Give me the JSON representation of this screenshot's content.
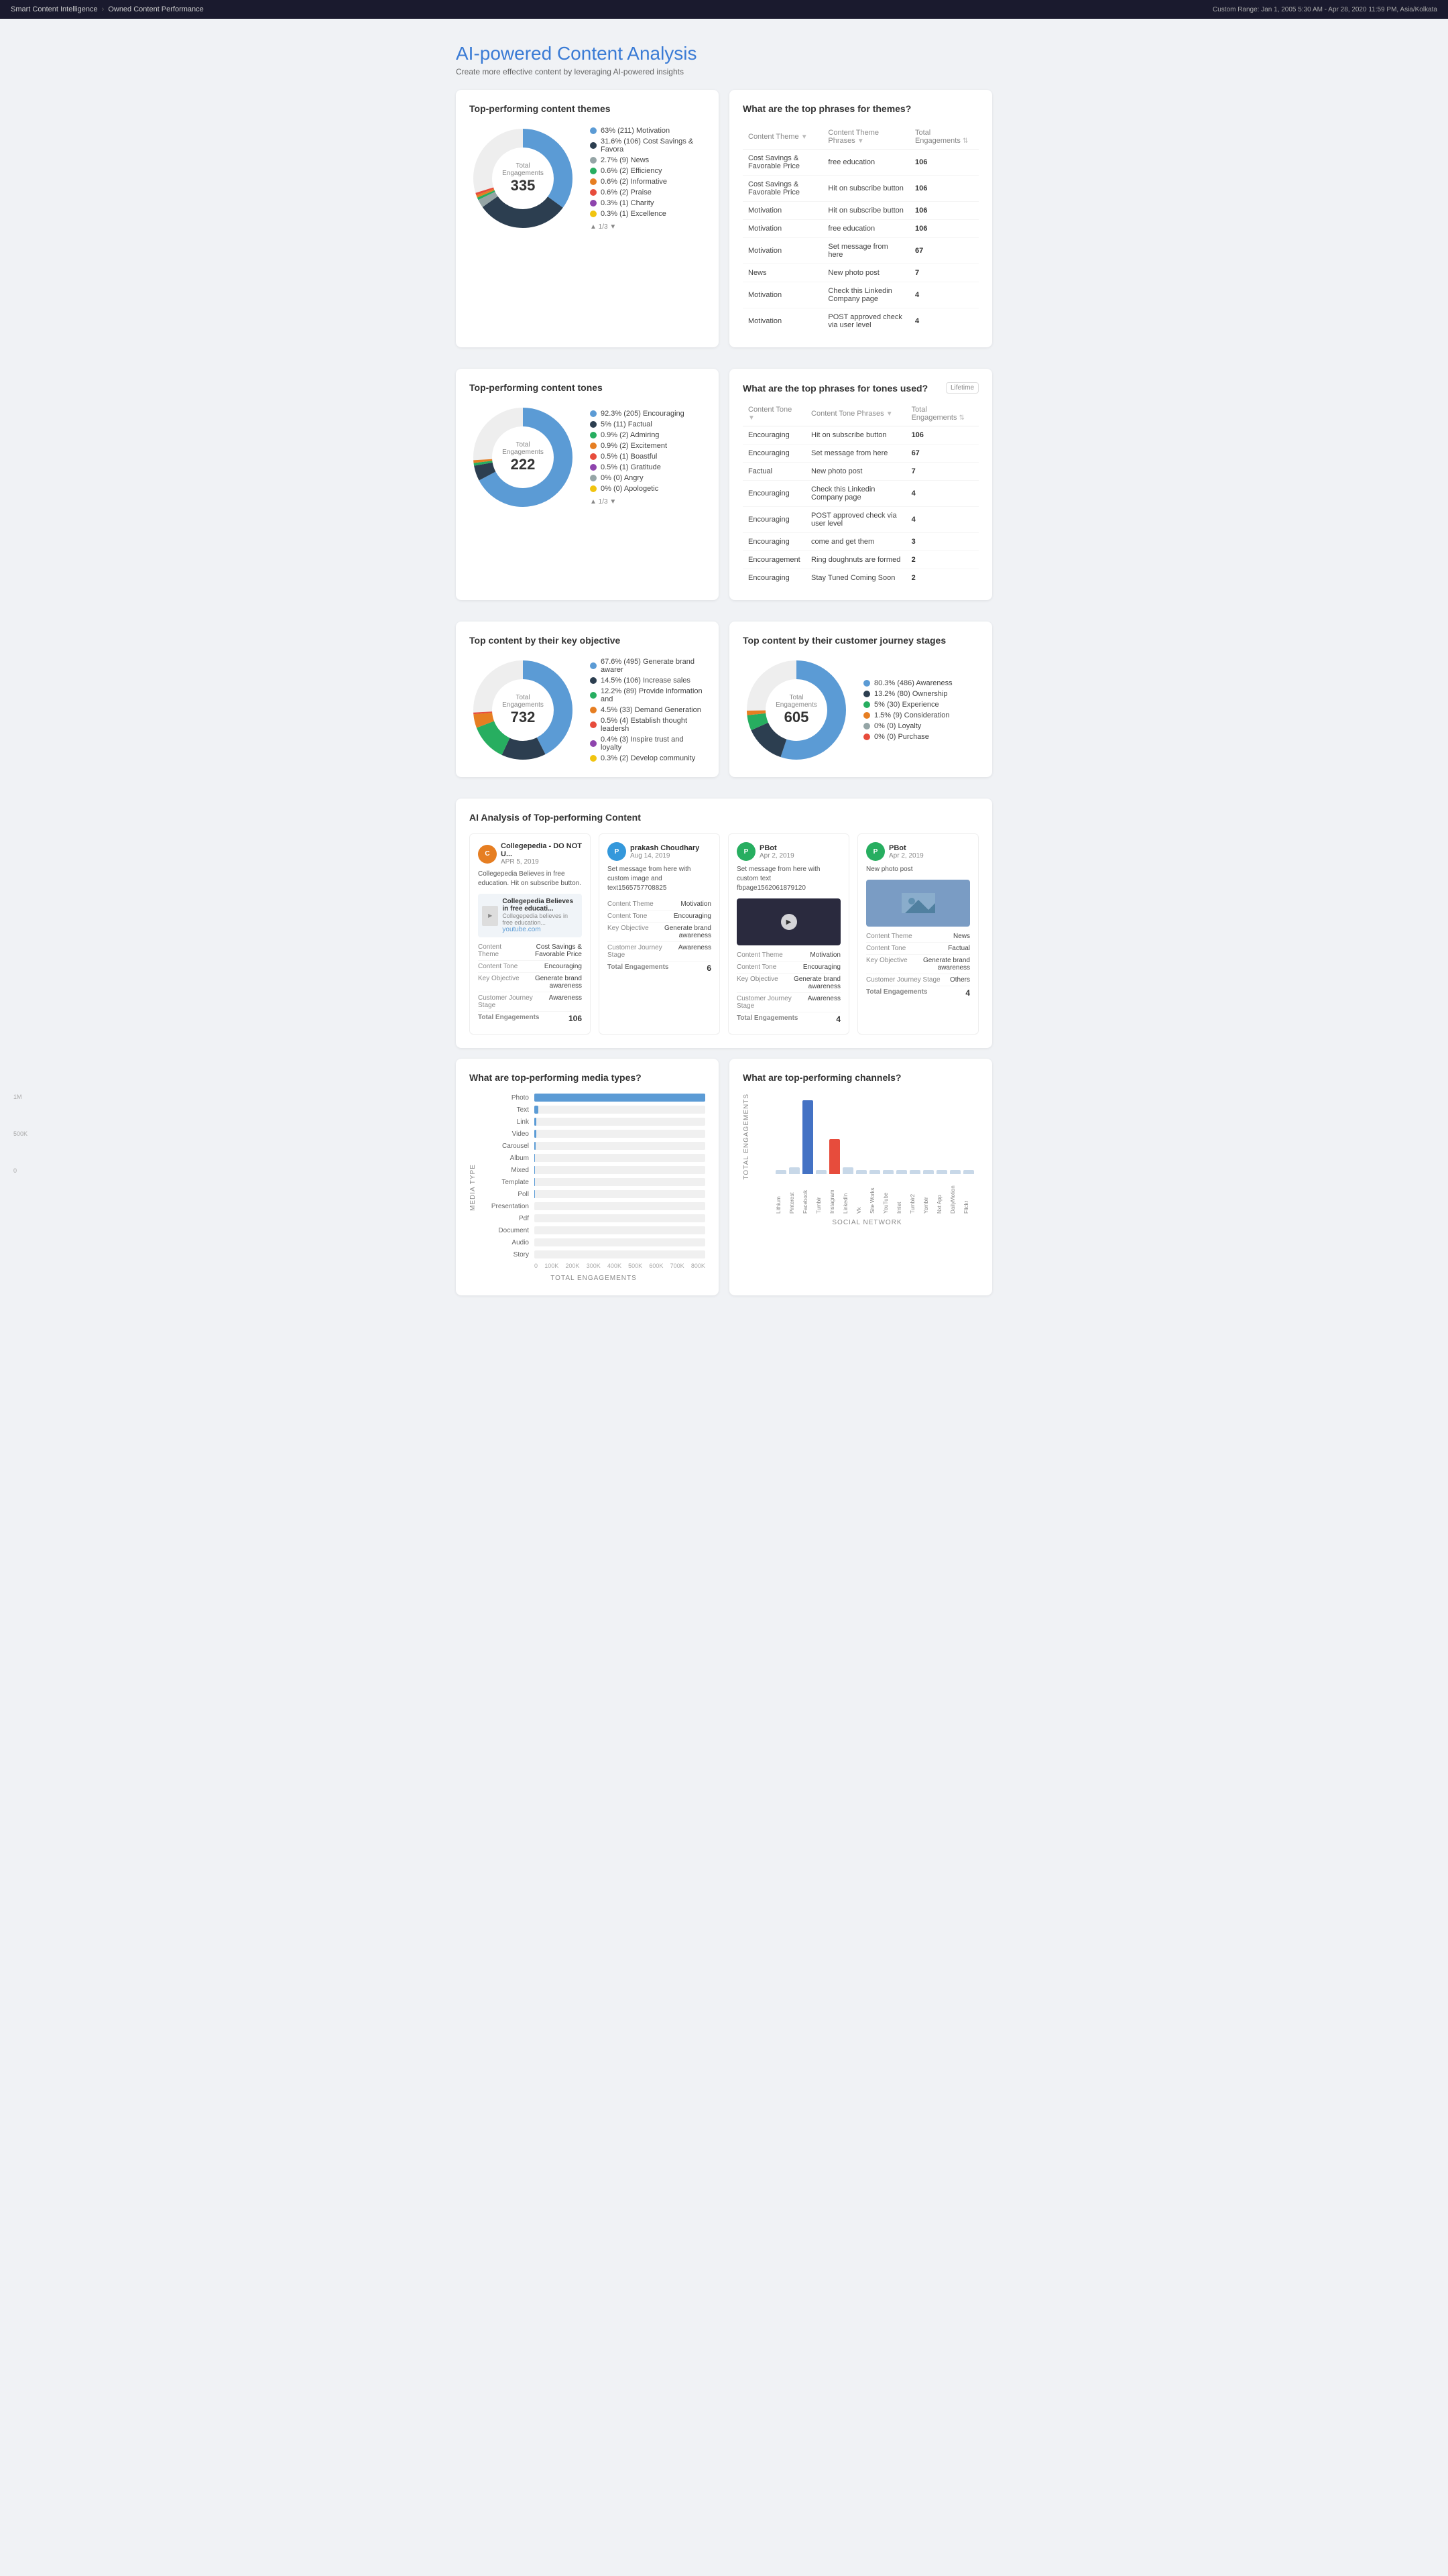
{
  "nav": {
    "brand": "Smart Content Intelligence",
    "breadcrumb": "Owned Content Performance",
    "dateRange": "Custom Range: Jan 1, 2005 5:30 AM - Apr 28, 2020 11:59 PM, Asia/Kolkata"
  },
  "pageHeader": {
    "title": "AI-powered Content Analysis",
    "subtitle": "Create more effective content by leveraging AI-powered insights"
  },
  "topThemes": {
    "sectionTitle": "Top-performing content themes",
    "totalEngagementsLabel": "Total Engagements",
    "totalEngagements": "335",
    "legend": [
      {
        "color": "#5b9bd5",
        "text": "63% (211) Motivation"
      },
      {
        "color": "#2c3e50",
        "text": "31.6% (106) Cost Savings & Favora"
      },
      {
        "color": "#95a5a6",
        "text": "2.7% (9) News"
      },
      {
        "color": "#27ae60",
        "text": "0.6% (2) Efficiency"
      },
      {
        "color": "#e67e22",
        "text": "0.6% (2) Informative"
      },
      {
        "color": "#e74c3c",
        "text": "0.6% (2) Praise"
      },
      {
        "color": "#8e44ad",
        "text": "0.3% (1) Charity"
      },
      {
        "color": "#f1c40f",
        "text": "0.3% (1) Excellence"
      }
    ],
    "moreLabel": "▲ 1/3 ▼"
  },
  "topThemePhrases": {
    "sectionTitle": "What are the top phrases for themes?",
    "columns": [
      "Content Theme",
      "Content Theme Phrases",
      "Total Engagements"
    ],
    "rows": [
      {
        "theme": "Cost Savings & Favorable Price",
        "phrase": "free education",
        "engagements": "106"
      },
      {
        "theme": "Cost Savings & Favorable Price",
        "phrase": "Hit on subscribe button",
        "engagements": "106"
      },
      {
        "theme": "Motivation",
        "phrase": "Hit on subscribe button",
        "engagements": "106"
      },
      {
        "theme": "Motivation",
        "phrase": "free education",
        "engagements": "106"
      },
      {
        "theme": "Motivation",
        "phrase": "Set message from here",
        "engagements": "67"
      },
      {
        "theme": "News",
        "phrase": "New photo post",
        "engagements": "7"
      },
      {
        "theme": "Motivation",
        "phrase": "Check this Linkedin Company page",
        "engagements": "4"
      },
      {
        "theme": "Motivation",
        "phrase": "POST approved check via user level",
        "engagements": "4"
      }
    ]
  },
  "topTones": {
    "sectionTitle": "Top-performing content tones",
    "totalEngagementsLabel": "Total Engagements",
    "totalEngagements": "222",
    "legend": [
      {
        "color": "#5b9bd5",
        "text": "92.3% (205) Encouraging"
      },
      {
        "color": "#2c3e50",
        "text": "5% (11) Factual"
      },
      {
        "color": "#27ae60",
        "text": "0.9% (2) Admiring"
      },
      {
        "color": "#e67e22",
        "text": "0.9% (2) Excitement"
      },
      {
        "color": "#e74c3c",
        "text": "0.5% (1) Boastful"
      },
      {
        "color": "#8e44ad",
        "text": "0.5% (1) Gratitude"
      },
      {
        "color": "#95a5a6",
        "text": "0% (0) Angry"
      },
      {
        "color": "#f1c40f",
        "text": "0% (0) Apologetic"
      }
    ],
    "moreLabel": "▲ 1/3 ▼"
  },
  "topTonePhrases": {
    "sectionTitle": "What are the top phrases for tones used?",
    "lifetimeLabel": "Lifetime",
    "columns": [
      "Content Tone",
      "Content Tone Phrases",
      "Total Engagements"
    ],
    "rows": [
      {
        "tone": "Encouraging",
        "phrase": "Hit on subscribe button",
        "engagements": "106"
      },
      {
        "tone": "Encouraging",
        "phrase": "Set message from here",
        "engagements": "67"
      },
      {
        "tone": "Factual",
        "phrase": "New photo post",
        "engagements": "7"
      },
      {
        "tone": "Encouraging",
        "phrase": "Check this Linkedin Company page",
        "engagements": "4"
      },
      {
        "tone": "Encouraging",
        "phrase": "POST approved check via user level",
        "engagements": "4"
      },
      {
        "tone": "Encouraging",
        "phrase": "come and get them",
        "engagements": "3"
      },
      {
        "tone": "Encouragement",
        "phrase": "Ring doughnuts are formed",
        "engagements": "2"
      },
      {
        "tone": "Encouraging",
        "phrase": "Stay Tuned Coming Soon",
        "engagements": "2"
      }
    ]
  },
  "topObjectives": {
    "sectionTitle": "Top content by their key objective",
    "totalEngagementsLabel": "Total Engagements",
    "totalEngagements": "732",
    "legend": [
      {
        "color": "#5b9bd5",
        "text": "67.6% (495) Generate brand awarer"
      },
      {
        "color": "#2c3e50",
        "text": "14.5% (106) Increase sales"
      },
      {
        "color": "#27ae60",
        "text": "12.2% (89) Provide information and"
      },
      {
        "color": "#e67e22",
        "text": "4.5% (33) Demand Generation"
      },
      {
        "color": "#e74c3c",
        "text": "0.5% (4) Establish thought leadersh"
      },
      {
        "color": "#8e44ad",
        "text": "0.4% (3) Inspire trust and loyalty"
      },
      {
        "color": "#f1c40f",
        "text": "0.3% (2) Develop community"
      }
    ]
  },
  "topJourneyStages": {
    "sectionTitle": "Top content by their customer journey stages",
    "totalEngagementsLabel": "Total Engagements",
    "totalEngagements": "605",
    "legend": [
      {
        "color": "#5b9bd5",
        "text": "80.3% (486) Awareness"
      },
      {
        "color": "#2c3e50",
        "text": "13.2% (80) Ownership"
      },
      {
        "color": "#27ae60",
        "text": "5% (30) Experience"
      },
      {
        "color": "#e67e22",
        "text": "1.5% (9) Consideration"
      },
      {
        "color": "#95a5a6",
        "text": "0% (0) Loyalty"
      },
      {
        "color": "#e74c3c",
        "text": "0% (0) Purchase"
      }
    ]
  },
  "aiAnalysis": {
    "sectionTitle": "AI Analysis of Top-performing Content",
    "cards": [
      {
        "authorName": "Collegepedia - DO NOT U...",
        "date": "APR 5, 2019",
        "avatarBg": "#e67e22",
        "avatarInitial": "C",
        "description": "Collegepedia Believes in free education. Hit on subscribe button.",
        "hasLinkPreview": true,
        "linkTitle": "Collegepedia Believes in free educati...",
        "linkSubtitle": "Collegepedia believes in free education...",
        "linkUrl": "youtube.com",
        "contentTheme": "Cost Savings & Favorable Price",
        "contentTone": "Encouraging",
        "keyObjective": "Generate brand awareness",
        "journeyStage": "Awareness",
        "totalEngagements": "106"
      },
      {
        "authorName": "prakash Choudhary",
        "date": "Aug 14, 2019",
        "avatarBg": "#3498db",
        "avatarInitial": "P",
        "description": "Set message from here with custom image and text1565757708825",
        "hasLinkPreview": false,
        "contentTheme": "Motivation",
        "contentTone": "Encouraging",
        "keyObjective": "Generate brand awareness",
        "journeyStage": "Awareness",
        "totalEngagements": "6"
      },
      {
        "authorName": "PBot",
        "date": "Apr 2, 2019",
        "avatarBg": "#27ae60",
        "avatarInitial": "P",
        "description": "Set message from here with custom text fbpage1562061879120",
        "hasVideo": true,
        "contentTheme": "Motivation",
        "contentTone": "Encouraging",
        "keyObjective": "Generate brand awareness",
        "journeyStage": "Awareness",
        "totalEngagements": "4"
      },
      {
        "authorName": "PBot",
        "date": "Apr 2, 2019",
        "avatarBg": "#27ae60",
        "avatarInitial": "P",
        "description": "New photo post",
        "hasImage": true,
        "contentTheme": "News",
        "contentTone": "Factual",
        "keyObjective": "Generate brand awareness",
        "journeyStage": "Others",
        "totalEngagements": "4"
      }
    ]
  },
  "topMediaTypes": {
    "sectionTitle": "What are top-performing media types?",
    "yAxisLabel": "MEDIA TYPE",
    "xAxisLabel": "TOTAL ENGAGEMENTS",
    "bars": [
      {
        "label": "Photo",
        "value": 800,
        "maxValue": 800
      },
      {
        "label": "Text",
        "value": 20,
        "maxValue": 800
      },
      {
        "label": "Link",
        "value": 10,
        "maxValue": 800
      },
      {
        "label": "Video",
        "value": 8,
        "maxValue": 800
      },
      {
        "label": "Carousel",
        "value": 5,
        "maxValue": 800
      },
      {
        "label": "Album",
        "value": 4,
        "maxValue": 800
      },
      {
        "label": "Mixed",
        "value": 3,
        "maxValue": 800
      },
      {
        "label": "Template",
        "value": 2,
        "maxValue": 800
      },
      {
        "label": "Poll",
        "value": 1,
        "maxValue": 800
      },
      {
        "label": "Presentation",
        "value": 0,
        "maxValue": 800
      },
      {
        "label": "Pdf",
        "value": 0,
        "maxValue": 800
      },
      {
        "label": "Document",
        "value": 0,
        "maxValue": 800
      },
      {
        "label": "Audio",
        "value": 0,
        "maxValue": 800
      },
      {
        "label": "Story",
        "value": 0,
        "maxValue": 800
      }
    ],
    "xAxisTicks": [
      "0",
      "100K",
      "200K",
      "300K",
      "400K",
      "500K",
      "600K",
      "700K",
      "800K"
    ]
  },
  "topChannels": {
    "sectionTitle": "What are top-performing channels?",
    "yAxisLabel": "TOTAL ENGAGEMENTS",
    "xAxisLabel": "SOCIAL NETWORK",
    "yTicks": [
      "1M",
      "500K",
      "0"
    ],
    "channels": [
      {
        "label": "Lithium",
        "value": 5,
        "color": "#c8d8e8"
      },
      {
        "label": "Pinterest",
        "value": 8,
        "color": "#c8d8e8"
      },
      {
        "label": "Facebook",
        "value": 85,
        "color": "#4472c4"
      },
      {
        "label": "Tumblr",
        "value": 5,
        "color": "#c8d8e8"
      },
      {
        "label": "Instagram",
        "value": 40,
        "color": "#e74c3c"
      },
      {
        "label": "LinkedIn",
        "value": 8,
        "color": "#c8d8e8"
      },
      {
        "label": "Vk",
        "value": 5,
        "color": "#c8d8e8"
      },
      {
        "label": "Site Works",
        "value": 5,
        "color": "#c8d8e8"
      },
      {
        "label": "YouTube",
        "value": 5,
        "color": "#c8d8e8"
      },
      {
        "label": "Imlet",
        "value": 5,
        "color": "#c8d8e8"
      },
      {
        "label": "Tumblr2",
        "value": 5,
        "color": "#c8d8e8"
      },
      {
        "label": "Yomblr",
        "value": 5,
        "color": "#c8d8e8"
      },
      {
        "label": "Nxt App",
        "value": 5,
        "color": "#c8d8e8"
      },
      {
        "label": "DailyMotion",
        "value": 5,
        "color": "#c8d8e8"
      },
      {
        "label": "Flickr",
        "value": 5,
        "color": "#c8d8e8"
      }
    ]
  }
}
